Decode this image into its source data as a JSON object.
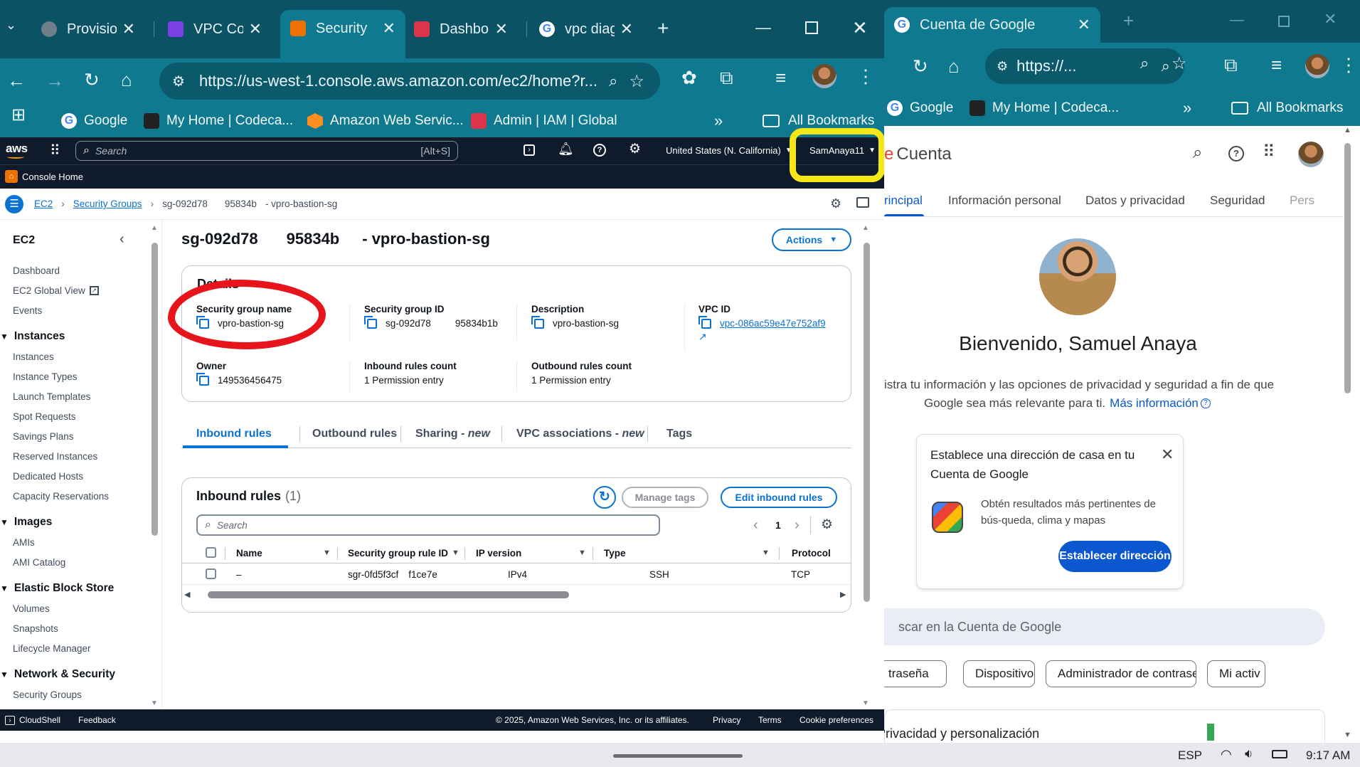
{
  "left_window": {
    "tabs": [
      {
        "title": "Provision",
        "icon": "provision-favicon",
        "color": "#6f7f8a"
      },
      {
        "title": "VPC Con",
        "icon": "vpc-console-favicon",
        "color": "#7b3fe4"
      },
      {
        "title": "Security",
        "icon": "aws-ec2-favicon",
        "color": "#ed7100"
      },
      {
        "title": "Dashbo",
        "icon": "dashboard-favicon",
        "color": "#dd344c"
      },
      {
        "title": "vpc diag",
        "icon": "google-favicon",
        "color": "#ffffff"
      }
    ],
    "new_tab": "+",
    "address": "https://us-west-1.console.aws.amazon.com/ec2/home?r...",
    "bookmarks": [
      {
        "label": "Google",
        "icon": "google-favicon"
      },
      {
        "label": "My Home | Codeca...",
        "icon": "codecademy-favicon"
      },
      {
        "label": "Amazon Web Servic...",
        "icon": "aws-favicon"
      },
      {
        "label": "Admin | IAM | Global",
        "icon": "admin-favicon"
      }
    ],
    "bookmarks_overflow": "»",
    "all_bookmarks": "All Bookmarks"
  },
  "aws": {
    "logo": "aws",
    "search_placeholder": "Search",
    "search_shortcut": "[Alt+S]",
    "region": "United States (N. California)",
    "account": "SamAnaya11",
    "console_home": "Console Home",
    "breadcrumb": [
      "EC2",
      "Security Groups",
      "sg-092d78",
      "95834b",
      "- vpro-bastion-sg"
    ]
  },
  "sidebar": {
    "title": "EC2",
    "top_items": [
      "Dashboard",
      "EC2 Global View",
      "Events"
    ],
    "sections": [
      {
        "title": "Instances",
        "items": [
          "Instances",
          "Instance Types",
          "Launch Templates",
          "Spot Requests",
          "Savings Plans",
          "Reserved Instances",
          "Dedicated Hosts",
          "Capacity Reservations"
        ]
      },
      {
        "title": "Images",
        "items": [
          "AMIs",
          "AMI Catalog"
        ]
      },
      {
        "title": "Elastic Block Store",
        "items": [
          "Volumes",
          "Snapshots",
          "Lifecycle Manager"
        ]
      },
      {
        "title": "Network & Security",
        "items": [
          "Security Groups"
        ]
      }
    ]
  },
  "page": {
    "title_id": "sg-092d78",
    "title_suffix": "95834b",
    "title_name": "- vpro-bastion-sg",
    "actions": "Actions",
    "details_heading": "Details",
    "fields": {
      "sg_name_label": "Security group name",
      "sg_name": "vpro-bastion-sg",
      "sg_id_label": "Security group ID",
      "sg_id_a": "sg-092d78",
      "sg_id_b": "95834b1b",
      "desc_label": "Description",
      "desc": "vpro-bastion-sg",
      "vpc_label": "VPC ID",
      "vpc": "vpc-086ac59e47e752af9",
      "owner_label": "Owner",
      "owner": "149536456475",
      "in_count_label": "Inbound rules count",
      "in_count": "1 Permission entry",
      "out_count_label": "Outbound rules count",
      "out_count": "1 Permission entry"
    },
    "tabs": [
      {
        "label": "Inbound rules",
        "suffix": ""
      },
      {
        "label": "Outbound rules",
        "suffix": ""
      },
      {
        "label": "Sharing - ",
        "suffix": "new"
      },
      {
        "label": "VPC associations - ",
        "suffix": "new"
      },
      {
        "label": "Tags",
        "suffix": ""
      }
    ],
    "rules": {
      "title": "Inbound rules",
      "count": "(1)",
      "manage_tags": "Manage tags",
      "edit": "Edit inbound rules",
      "search_placeholder": "Search",
      "page": "1",
      "columns": [
        "Name",
        "Security group rule ID",
        "IP version",
        "Type",
        "Protocol"
      ],
      "rows": [
        {
          "name": "–",
          "rule_id_a": "sgr-0fd5f3cf",
          "rule_id_b": "f1ce7e",
          "ip": "IPv4",
          "type": "SSH",
          "protocol": "TCP"
        }
      ]
    }
  },
  "footer": {
    "cloudshell": "CloudShell",
    "feedback": "Feedback",
    "copyright": "© 2025, Amazon Web Services, Inc. or its affiliates.",
    "privacy": "Privacy",
    "terms": "Terms",
    "cookies": "Cookie preferences"
  },
  "right_window": {
    "tab_title": "Cuenta de Google",
    "address": "https://...",
    "bookmarks": [
      {
        "label": "Google"
      },
      {
        "label": "My Home | Codeca..."
      }
    ],
    "bookmarks_overflow": "»",
    "all_bookmarks": "All Bookmarks",
    "brand": "Cuenta",
    "brand_prefix": "e",
    "nav": [
      "rincipal",
      "Información personal",
      "Datos y privacidad",
      "Seguridad",
      "Pers"
    ],
    "welcome": "Bienvenido, Samuel Anaya",
    "subtitle_1": "istra tu información y las opciones de privacidad y seguridad a fin de que",
    "subtitle_2": "Google sea más relevante para ti.",
    "more_info": "Más información",
    "card_title": "Establece una dirección de casa en tu Cuenta de Google",
    "card_body": "Obtén resultados más pertinentes de bús-queda, clima y mapas",
    "card_button": "Establecer dirección",
    "search_placeholder": "scar en la Cuenta de Google",
    "chips": [
      "traseña",
      "Dispositivos",
      "Administrador de contraseñas",
      "Mi activ"
    ],
    "bottom_peek": "Privacidad y personalización"
  },
  "taskbar": {
    "language": "ESP",
    "time": "9:17 AM"
  },
  "colors": {
    "chrome_dark": "#0b5265",
    "chrome_toolbar": "#0f7a8f",
    "aws_nav": "#0f1b2a",
    "aws_blue": "#0972d3",
    "google_blue": "#0b57d0",
    "annotation_yellow": "#f5e616",
    "annotation_red": "#e8141b"
  }
}
